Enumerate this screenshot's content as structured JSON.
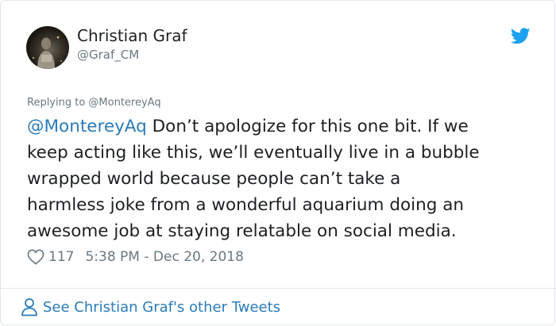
{
  "author": {
    "name": "Christian Graf",
    "handle": "@Graf_CM"
  },
  "icons": {
    "avatar": "profile-photo",
    "brand": "twitter-bird-icon",
    "like": "heart-outline-icon",
    "profile": "person-icon"
  },
  "colors": {
    "link": "#2b7bb9",
    "twitter_blue": "#1da1f2",
    "muted": "#697882",
    "text": "#1c2022"
  },
  "reply": {
    "label": "Replying to @MontereyAq"
  },
  "tweet": {
    "mention": "@MontereyAq",
    "line1_rest": " Don’t apologize for this one bit.  If we",
    "line2": "keep acting like this, we’ll eventually live in a bubble",
    "line3": "wrapped world because people can’t take a",
    "line4": "harmless joke from a wonderful aquarium doing an",
    "line5": "awesome job at staying relatable on social media."
  },
  "meta": {
    "likes": "117",
    "timestamp": "5:38 PM - Dec 20, 2018"
  },
  "footer": {
    "link_text": "See Christian Graf's other Tweets"
  }
}
